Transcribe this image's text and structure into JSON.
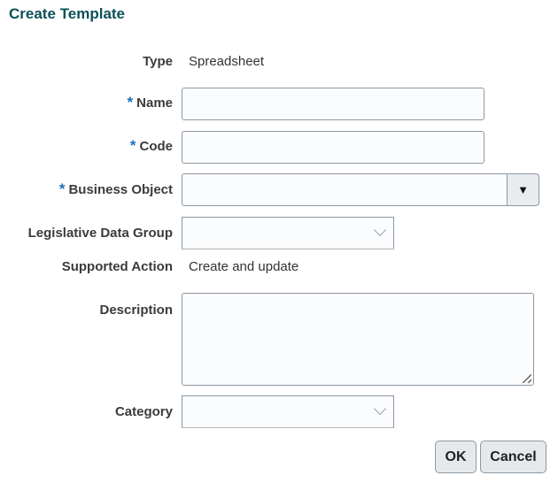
{
  "title": "Create Template",
  "fields": {
    "type": {
      "label": "Type",
      "value": "Spreadsheet"
    },
    "name": {
      "label": "Name",
      "required": "*",
      "value": ""
    },
    "code": {
      "label": "Code",
      "required": "*",
      "value": ""
    },
    "business_object": {
      "label": "Business Object",
      "required": "*",
      "value": "",
      "button_icon": "▼"
    },
    "legislative_data_group": {
      "label": "Legislative Data Group",
      "value": ""
    },
    "supported_action": {
      "label": "Supported Action",
      "value": "Create and update"
    },
    "description": {
      "label": "Description",
      "value": ""
    },
    "category": {
      "label": "Category",
      "value": ""
    }
  },
  "buttons": {
    "ok": "OK",
    "cancel": "Cancel"
  }
}
